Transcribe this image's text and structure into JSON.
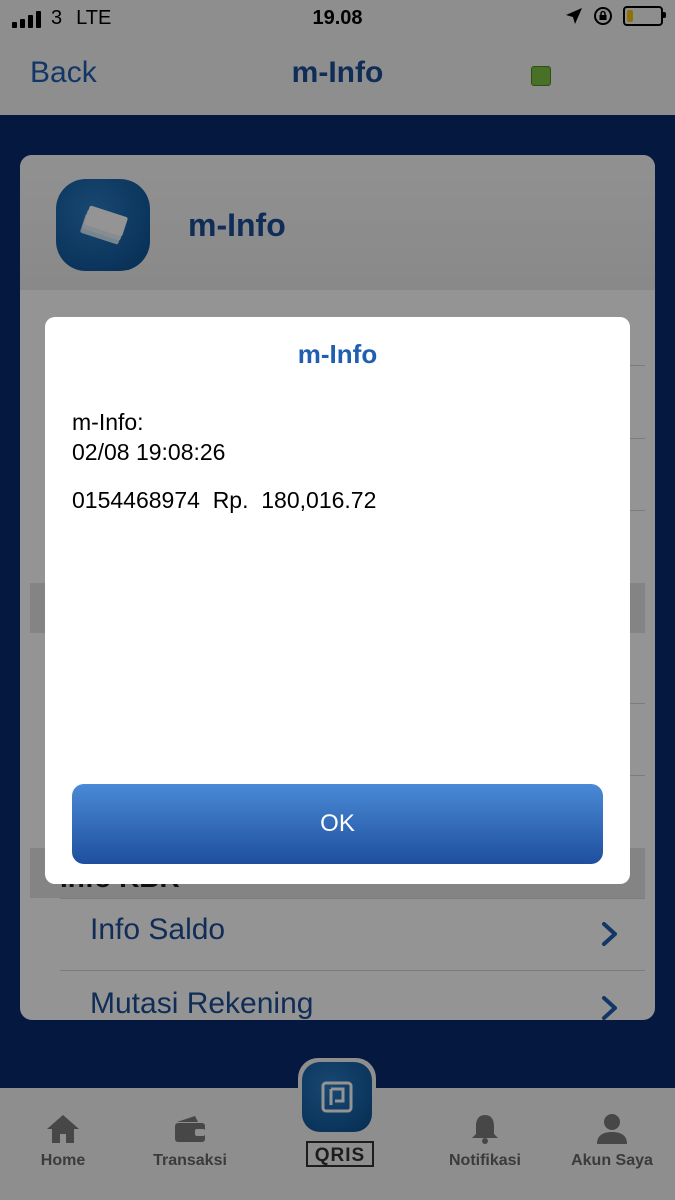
{
  "status_bar": {
    "carrier": "3",
    "network": "LTE",
    "time": "19.08"
  },
  "nav": {
    "back_label": "Back",
    "title": "m-Info"
  },
  "card": {
    "title": "m-Info",
    "section_label": "Info KBR",
    "rows": [
      {
        "label": "Info Saldo"
      },
      {
        "label": "Mutasi Rekening"
      }
    ]
  },
  "dialog": {
    "title": "m-Info",
    "line1": "m-Info:",
    "line2": "02/08 19:08:26",
    "line3": "0154468974  Rp.  180,016.72",
    "ok_label": "OK"
  },
  "tabs": [
    {
      "label": "Home",
      "icon": "home-icon"
    },
    {
      "label": "Transaksi",
      "icon": "wallet-icon"
    },
    {
      "label": "QRIS",
      "icon": "qris-icon"
    },
    {
      "label": "Notifikasi",
      "icon": "bell-icon"
    },
    {
      "label": "Akun Saya",
      "icon": "person-icon"
    }
  ],
  "colors": {
    "accent": "#1f5fb0",
    "title_blue": "#1d4e96",
    "background_blue": "#0a2a6e",
    "status_dot": "#7cc242",
    "battery": "#f2c511"
  }
}
